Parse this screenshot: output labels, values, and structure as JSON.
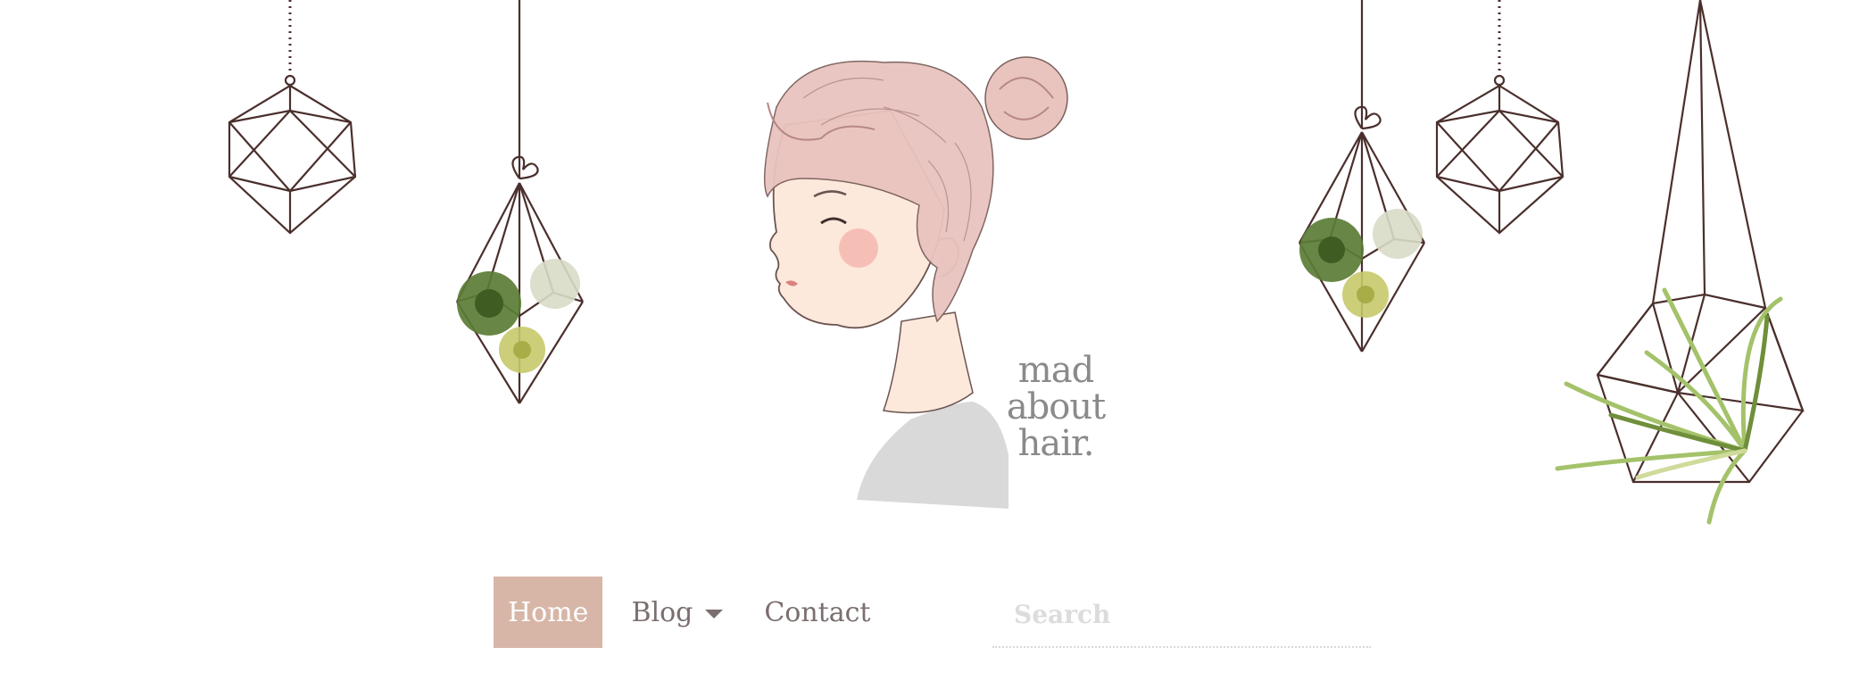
{
  "logo": {
    "line1": "mad",
    "line2": "about",
    "line3": "hair."
  },
  "nav": {
    "items": [
      {
        "label": "Home",
        "active": true
      },
      {
        "label": "Blog",
        "has_dropdown": true
      },
      {
        "label": "Contact"
      }
    ]
  },
  "search": {
    "placeholder": "Search",
    "value": ""
  },
  "colors": {
    "accent": "#d7b6a8",
    "nav_text": "#7b6e6e",
    "line": "#4a2f2c",
    "succulent_dark": "#5b7d36",
    "succulent_light": "#c6c96a",
    "succulent_pale": "#d8dcc6",
    "hair": "#e9c4bf",
    "skin": "#fde8dc"
  }
}
